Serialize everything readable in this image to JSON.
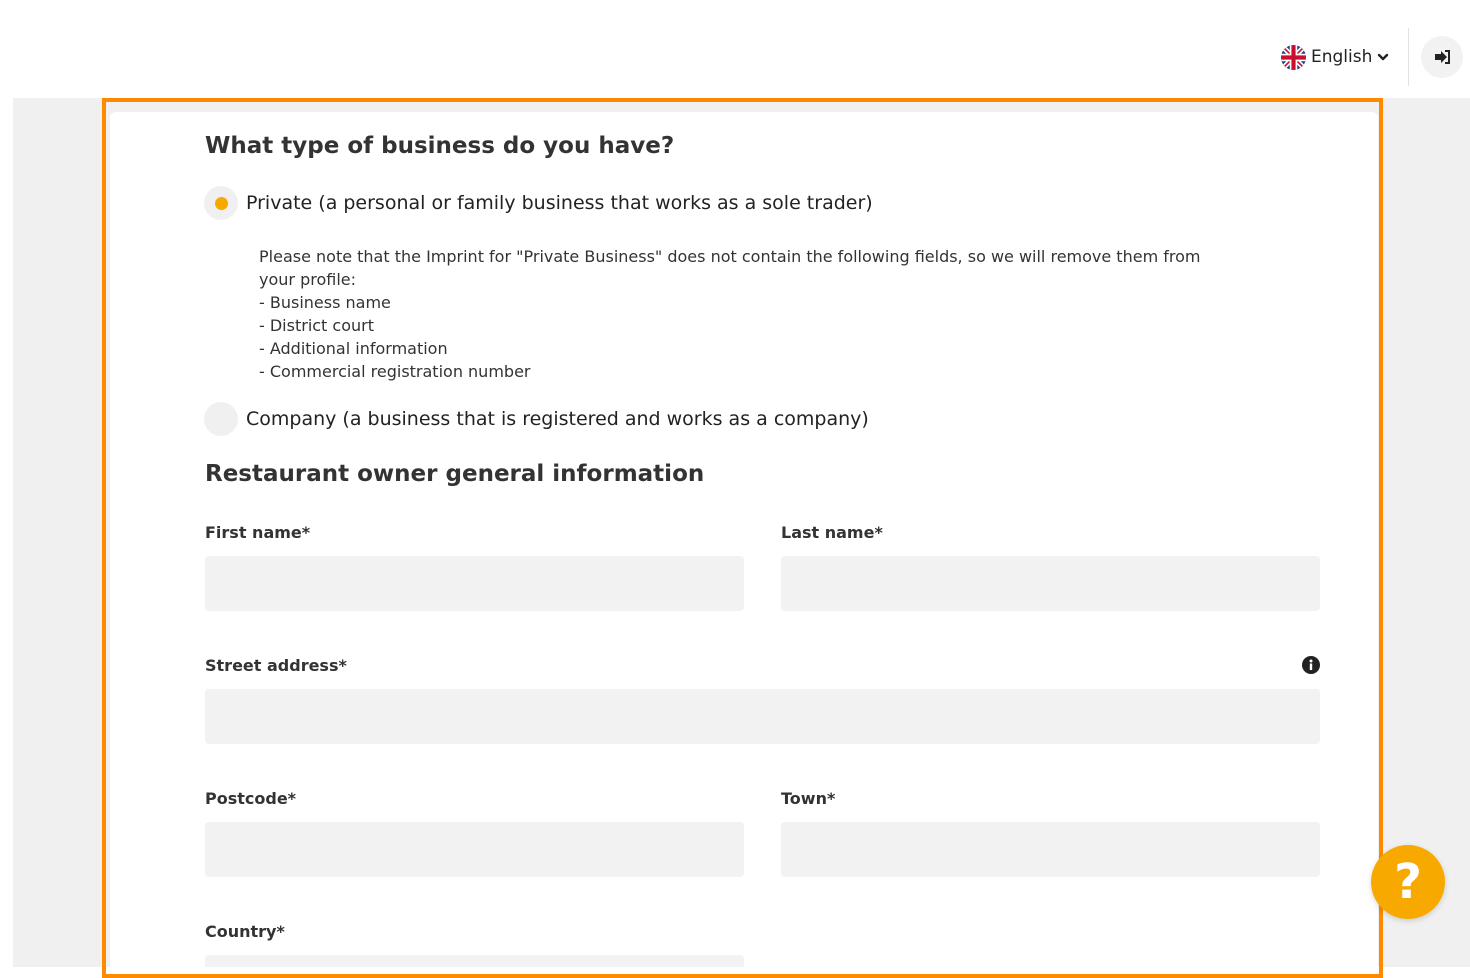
{
  "header": {
    "language_label": "English",
    "language_icon": "uk-flag-icon",
    "logout_icon": "sign-out-icon"
  },
  "business_type": {
    "title": "What type of business do you have?",
    "options": [
      {
        "label": "Private (a personal or family business that works as a sole trader)",
        "selected": true
      },
      {
        "label": "Company (a business that is registered and works as a company)",
        "selected": false
      }
    ],
    "note": {
      "intro_1": "Please note that the Imprint for \"Private Business\" does not contain the following fields, so we will remove them from",
      "intro_2": "your profile:",
      "items": [
        "- Business name",
        "- District court",
        "- Additional information",
        "- Commercial registration number"
      ]
    }
  },
  "owner_info": {
    "title": "Restaurant owner general information",
    "first_name": {
      "label": "First name*",
      "value": ""
    },
    "last_name": {
      "label": "Last name*",
      "value": ""
    },
    "street": {
      "label": "Street address*",
      "value": ""
    },
    "postcode": {
      "label": "Postcode*",
      "value": ""
    },
    "town": {
      "label": "Town*",
      "value": ""
    },
    "country": {
      "label": "Country*",
      "value": ""
    }
  },
  "help_button": {
    "icon": "help-icon",
    "glyph": "?"
  },
  "colors": {
    "accent": "#f7a900",
    "highlight_border": "#ff8a00",
    "field_bg": "#f2f2f2",
    "page_bg": "#f0f0f0"
  }
}
